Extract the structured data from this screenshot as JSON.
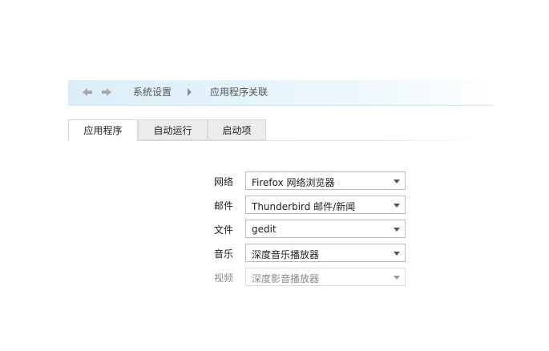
{
  "breadcrumb": {
    "back_icon": "arrow-left-icon",
    "forward_icon": "arrow-right-icon",
    "items": [
      "系统设置",
      "应用程序关联"
    ]
  },
  "tabs": [
    {
      "label": "应用程序",
      "active": true
    },
    {
      "label": "自动运行",
      "active": false
    },
    {
      "label": "启动项",
      "active": false
    }
  ],
  "defaults": [
    {
      "label": "网络",
      "value": "Firefox 网络浏览器",
      "enabled": true
    },
    {
      "label": "邮件",
      "value": "Thunderbird 邮件/新闻",
      "enabled": true
    },
    {
      "label": "文件",
      "value": "gedit",
      "enabled": true
    },
    {
      "label": "音乐",
      "value": "深度音乐播放器",
      "enabled": true
    },
    {
      "label": "视频",
      "value": "深度影音播放器",
      "enabled": false
    }
  ],
  "colors": {
    "breadcrumb_bg": "#dbeef8",
    "tab_inactive_bg": "#ececec",
    "border": "#b9b9b9"
  }
}
